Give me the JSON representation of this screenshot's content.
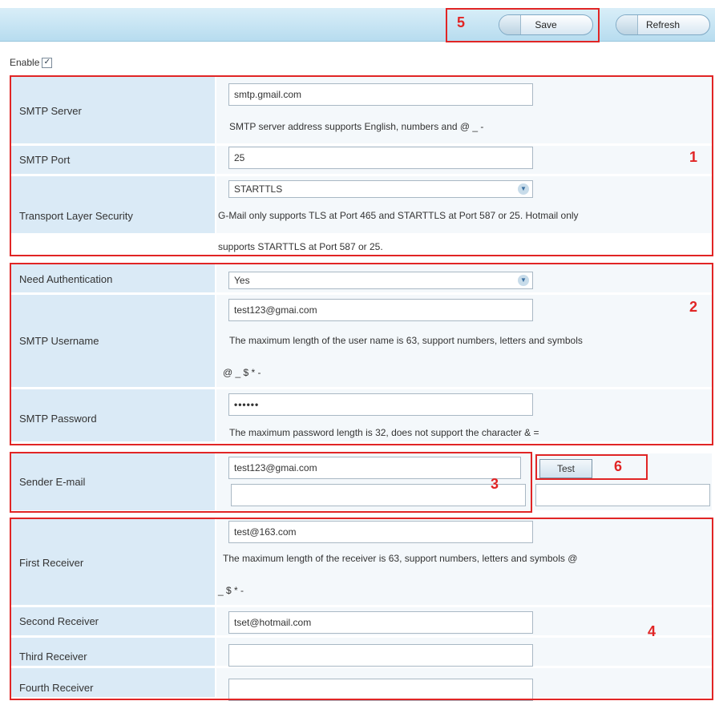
{
  "toolbar": {
    "save_label": "Save",
    "refresh_label": "Refresh"
  },
  "enable": {
    "label": "Enable",
    "checked": true
  },
  "smtp_server": {
    "label": "SMTP Server",
    "value": "smtp.gmail.com",
    "hint": "SMTP server address supports English, numbers and @ _ -"
  },
  "smtp_port": {
    "label": "SMTP Port",
    "value": "25"
  },
  "tls": {
    "label": "Transport Layer Security",
    "selected": "STARTTLS",
    "hint_line1": "G-Mail only supports TLS at Port 465 and STARTTLS at Port 587 or 25. Hotmail only",
    "hint_line2": "supports STARTTLS at Port 587 or 25."
  },
  "need_auth": {
    "label": "Need Authentication",
    "selected": "Yes"
  },
  "smtp_username": {
    "label": "SMTP Username",
    "value": "test123@gmai.com",
    "hint_line1": "The maximum length of the user name is 63, support numbers, letters and symbols",
    "hint_line2": "@ _ $ * -"
  },
  "smtp_password": {
    "label": "SMTP Password",
    "value": "••••••",
    "hint": "The maximum password length is 32, does not support the character & ="
  },
  "sender_email": {
    "label": "Sender E-mail",
    "value": "test123@gmai.com",
    "value2": "",
    "test_label": "Test"
  },
  "first_receiver": {
    "label": "First Receiver",
    "value": "test@163.com",
    "hint_line1": "The maximum length of the receiver is 63, support numbers, letters and symbols @",
    "hint_line2": "_ $ * -"
  },
  "second_receiver": {
    "label": "Second Receiver",
    "value": "tset@hotmail.com"
  },
  "third_receiver": {
    "label": "Third Receiver",
    "value": ""
  },
  "fourth_receiver": {
    "label": "Fourth Receiver",
    "value": ""
  },
  "annotations": [
    "1",
    "2",
    "3",
    "4",
    "5",
    "6"
  ],
  "colors": {
    "annotation_red": "#e12525",
    "label_bg": "#daeaf6",
    "header_bg": "#b7dcef"
  }
}
